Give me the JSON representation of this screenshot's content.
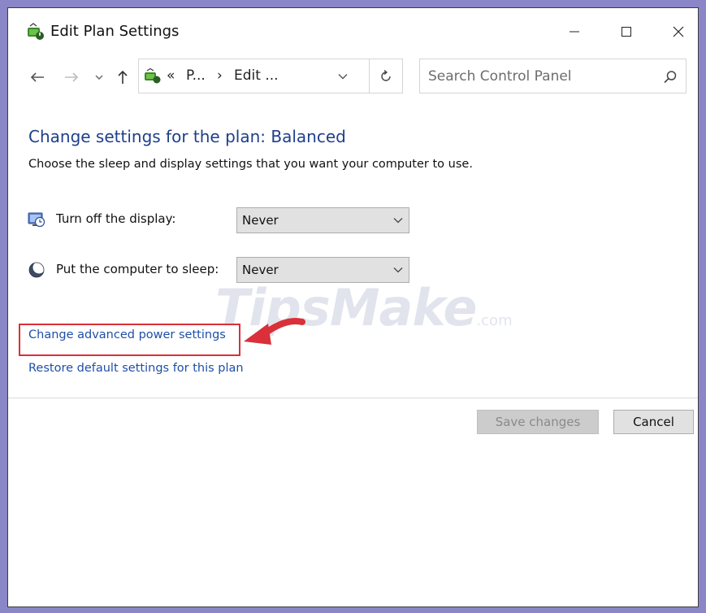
{
  "window": {
    "title": "Edit Plan Settings",
    "icon": "power-plan-icon"
  },
  "nav": {
    "back_icon": "back-arrow-icon",
    "forward_icon": "forward-arrow-icon",
    "recent_icon": "chevron-down-icon",
    "up_icon": "up-arrow-icon",
    "address": {
      "overflow": "«",
      "segments": [
        "P...",
        "Edit ..."
      ],
      "separator": "›"
    },
    "search_placeholder": "Search Control Panel"
  },
  "content": {
    "heading": "Change settings for the plan: Balanced",
    "subheading": "Choose the sleep and display settings that you want your computer to use.",
    "settings": [
      {
        "label": "Turn off the display:",
        "value": "Never",
        "icon": "monitor-clock-icon"
      },
      {
        "label": "Put the computer to sleep:",
        "value": "Never",
        "icon": "moon-icon"
      }
    ],
    "links": {
      "advanced": "Change advanced power settings",
      "restore": "Restore default settings for this plan"
    }
  },
  "buttons": {
    "save": "Save changes",
    "cancel": "Cancel"
  },
  "annotation": {
    "color": "#d9303a"
  },
  "watermark": {
    "text": "TipsMake",
    "suffix": ".com"
  },
  "colors": {
    "accent": "#1e3f8a",
    "link": "#1e4fa8",
    "background": "#8a86c7"
  }
}
